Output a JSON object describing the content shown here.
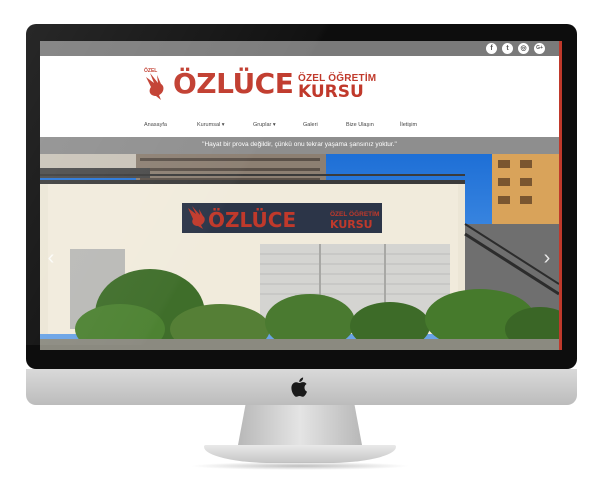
{
  "header": {
    "logo_small": "ÖZEL",
    "logo_name": "ÖZLÜCE",
    "logo_sub1": "ÖZEL ÖĞRETİM",
    "logo_sub2": "KURSU"
  },
  "social": [
    {
      "icon": "facebook-icon",
      "glyph": "f"
    },
    {
      "icon": "twitter-icon",
      "glyph": "t"
    },
    {
      "icon": "instagram-icon",
      "glyph": "◎"
    },
    {
      "icon": "googleplus-icon",
      "glyph": "G+"
    }
  ],
  "nav": {
    "items": [
      "Anasayfa",
      "Kurumsal ▾",
      "Gruplar ▾",
      "Galeri",
      "Bize Ulaşın",
      "İletişim"
    ]
  },
  "slogan": "\"Hayat bir prova değildir, çünkü onu tekrar yaşama şansınız yoktur.\"",
  "hero": {
    "sign_name": "ÖZLÜCE",
    "sign_sub1": "ÖZEL ÖĞRETİM",
    "sign_sub2": "KURSU",
    "prev_glyph": "‹",
    "next_glyph": "›"
  },
  "colors": {
    "brand_red": "#c0392b",
    "bar_gray": "#7a7a7a",
    "slogan_gray": "#8e8e8e"
  }
}
